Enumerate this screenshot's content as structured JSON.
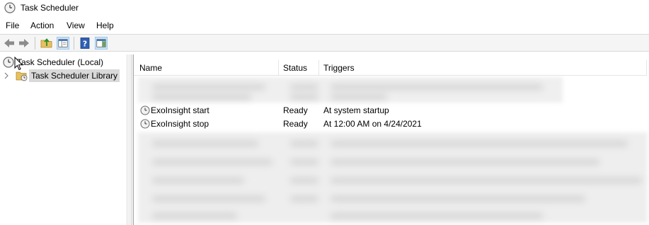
{
  "window": {
    "title": "Task Scheduler",
    "icon": "clock-icon"
  },
  "menu": {
    "items": [
      "File",
      "Action",
      "View",
      "Help"
    ]
  },
  "toolbar": {
    "buttons": [
      "back-arrow-icon",
      "forward-arrow-icon",
      "up-folder-icon",
      "show-hide-tree-icon",
      "help-icon",
      "action-pane-icon"
    ]
  },
  "tree": {
    "root_label": "Task Scheduler (Local)",
    "library_label": "Task Scheduler Library"
  },
  "table": {
    "columns": [
      "Name",
      "Status",
      "Triggers"
    ],
    "rows": [
      {
        "name": "ExoInsight start",
        "status": "Ready",
        "trigger": "At system startup"
      },
      {
        "name": "ExoInsight stop",
        "status": "Ready",
        "trigger": "At 12:00 AM on 4/24/2021"
      }
    ]
  },
  "colors": {
    "selection_bg": "#d9d9d9",
    "toolbar_active": "#cce4f7",
    "clock_face": "#e8e8e8",
    "folder": "#e8c15f"
  }
}
